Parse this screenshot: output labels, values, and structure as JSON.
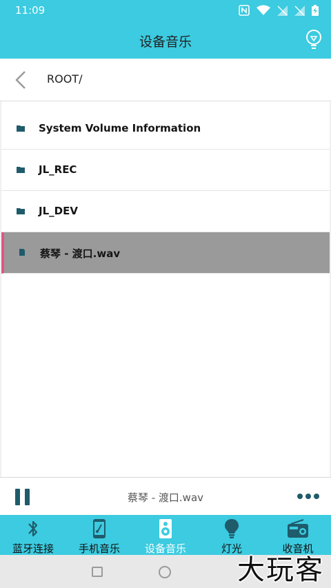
{
  "status": {
    "time": "11:09"
  },
  "header": {
    "title": "设备音乐"
  },
  "path": {
    "current": "ROOT/"
  },
  "files": [
    {
      "name": "System Volume Information",
      "type": "folder"
    },
    {
      "name": "JL_REC",
      "type": "folder"
    },
    {
      "name": "JL_DEV",
      "type": "folder"
    },
    {
      "name": "蔡琴 - 渡口.wav",
      "type": "file",
      "selected": true
    }
  ],
  "player": {
    "now_playing": "蔡琴 - 渡口.wav",
    "state": "playing"
  },
  "nav": [
    {
      "label": "蓝牙连接",
      "icon": "bluetooth-icon"
    },
    {
      "label": "手机音乐",
      "icon": "phone-music-icon"
    },
    {
      "label": "设备音乐",
      "icon": "speaker-icon",
      "active": true
    },
    {
      "label": "灯光",
      "icon": "lightbulb-icon"
    },
    {
      "label": "收音机",
      "icon": "radio-icon"
    }
  ],
  "watermark": "大玩客",
  "colors": {
    "accent": "#3ccbe0",
    "selected_row": "#9a9a9a",
    "selected_marker": "#e35585",
    "icon_dark": "#1f5b6b"
  }
}
